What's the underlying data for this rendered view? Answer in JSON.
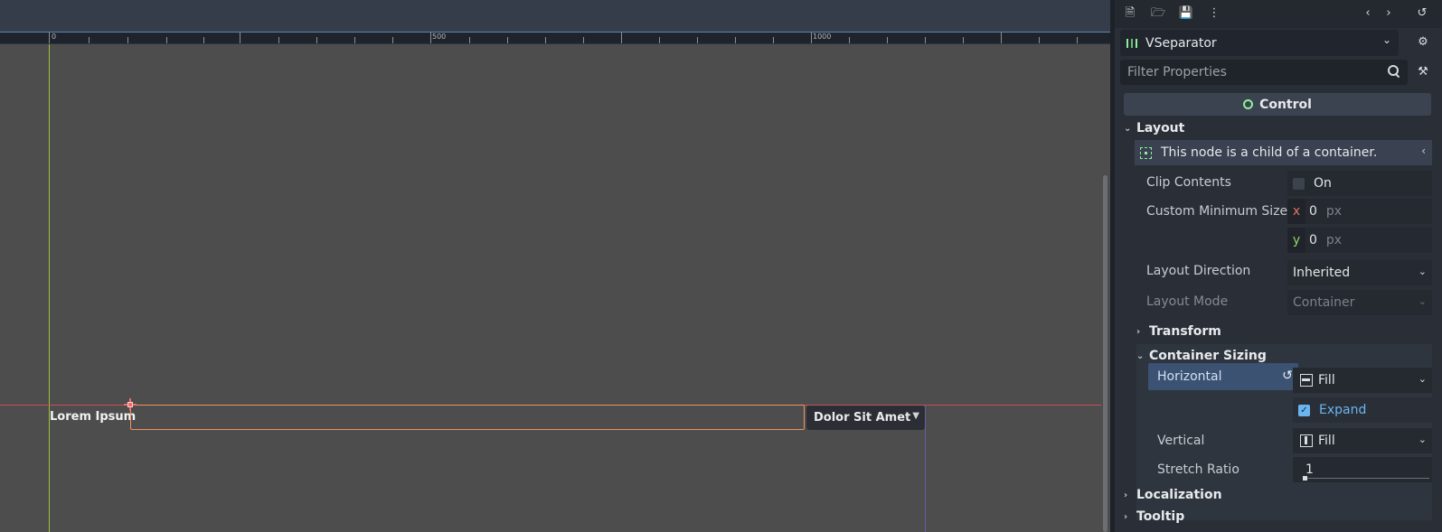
{
  "viewport": {
    "ruler_labels": [
      "0",
      "500",
      "1000"
    ],
    "canvas": {
      "label_text": "Lorem Ipsum",
      "option_button_text": "Dolor Sit Amet"
    }
  },
  "inspector": {
    "toolbar_icons": [
      "new-resource-icon",
      "open-folder-icon",
      "save-icon",
      "more-options-icon",
      "history-back-icon",
      "history-forward-icon",
      "object-history-icon"
    ],
    "node_selector": {
      "name": "VSeparator",
      "icon": "vseparator-icon"
    },
    "filter": {
      "placeholder": "Filter Properties"
    },
    "class_section": "Control",
    "layout": {
      "group_label": "Layout",
      "info_text": "This node is a child of a container.",
      "clip_contents": {
        "label": "Clip Contents",
        "checkbox_text": "On",
        "checked": false
      },
      "custom_min_size": {
        "label": "Custom Minimum Size",
        "x_label": "x",
        "x_value": "0",
        "y_label": "y",
        "y_value": "0",
        "unit": "px"
      },
      "layout_direction": {
        "label": "Layout Direction",
        "value": "Inherited"
      },
      "layout_mode": {
        "label": "Layout Mode",
        "value": "Container"
      },
      "transform_label": "Transform",
      "container_sizing": {
        "label": "Container Sizing",
        "horizontal": {
          "label": "Horizontal",
          "value": "Fill",
          "expand_label": "Expand",
          "expand": true
        },
        "vertical": {
          "label": "Vertical",
          "value": "Fill"
        },
        "stretch_ratio": {
          "label": "Stretch Ratio",
          "value": "1"
        }
      }
    },
    "localization_label": "Localization",
    "tooltip_label": "Tooltip",
    "colors": {
      "accent": "#8eef97",
      "highlight": "#3c5272",
      "selection": "#f0935a"
    }
  }
}
